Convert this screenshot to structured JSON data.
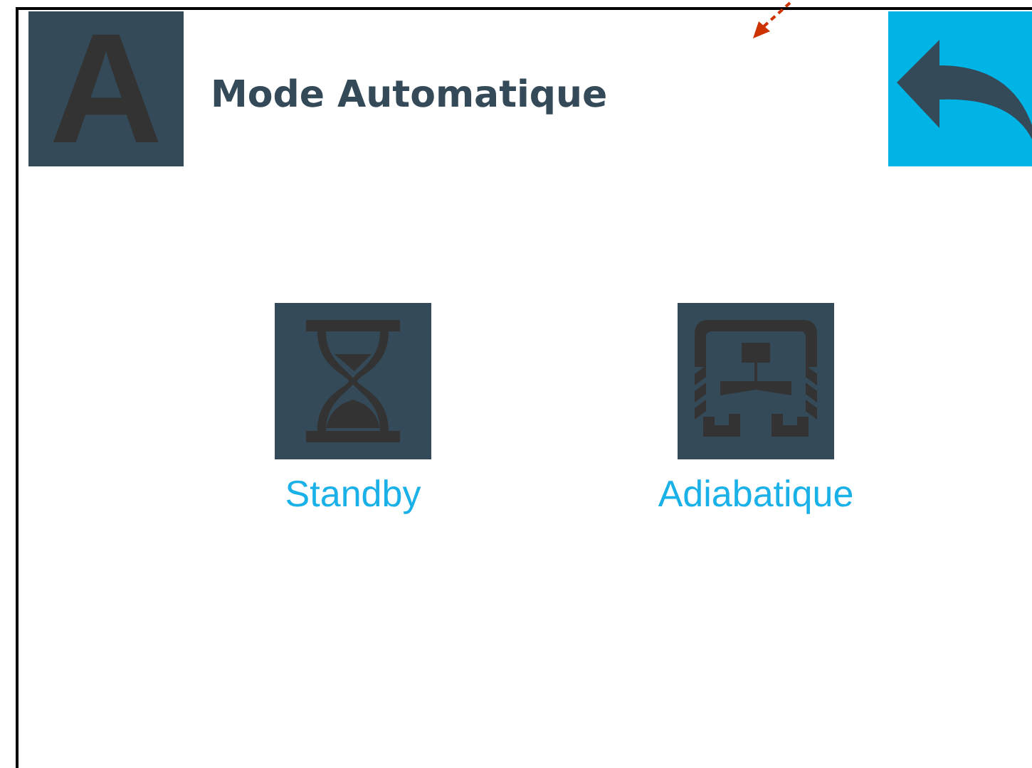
{
  "header": {
    "logo_letter": "A",
    "title": "Mode Automatique"
  },
  "modes": [
    {
      "kind": "hourglass",
      "label": "Standby"
    },
    {
      "kind": "adiabatic",
      "label": "Adiabatique"
    }
  ]
}
